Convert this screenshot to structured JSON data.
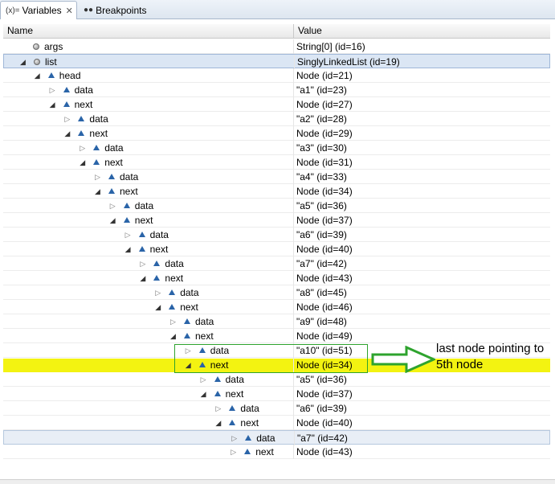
{
  "tabs": [
    {
      "label": "Variables",
      "icon": "variables-icon",
      "close": "✕"
    },
    {
      "label": "Breakpoints",
      "icon": "breakpoints-icon"
    }
  ],
  "columns": {
    "name": "Name",
    "value": "Value"
  },
  "rows": [
    {
      "name": "args",
      "value": "String[0]  (id=16)"
    },
    {
      "name": "list",
      "value": "SinglyLinkedList  (id=19)"
    },
    {
      "name": "head",
      "value": "Node  (id=21)"
    },
    {
      "name": "data",
      "value": "\"a1\" (id=23)"
    },
    {
      "name": "next",
      "value": "Node  (id=27)"
    },
    {
      "name": "data",
      "value": "\"a2\" (id=28)"
    },
    {
      "name": "next",
      "value": "Node  (id=29)"
    },
    {
      "name": "data",
      "value": "\"a3\" (id=30)"
    },
    {
      "name": "next",
      "value": "Node  (id=31)"
    },
    {
      "name": "data",
      "value": "\"a4\" (id=33)"
    },
    {
      "name": "next",
      "value": "Node  (id=34)"
    },
    {
      "name": "data",
      "value": "\"a5\" (id=36)"
    },
    {
      "name": "next",
      "value": "Node  (id=37)"
    },
    {
      "name": "data",
      "value": "\"a6\" (id=39)"
    },
    {
      "name": "next",
      "value": "Node  (id=40)"
    },
    {
      "name": "data",
      "value": "\"a7\" (id=42)"
    },
    {
      "name": "next",
      "value": "Node  (id=43)"
    },
    {
      "name": "data",
      "value": "\"a8\" (id=45)"
    },
    {
      "name": "next",
      "value": "Node  (id=46)"
    },
    {
      "name": "data",
      "value": "\"a9\" (id=48)"
    },
    {
      "name": "next",
      "value": "Node  (id=49)"
    },
    {
      "name": "data",
      "value": "\"a10\" (id=51)"
    },
    {
      "name": "next",
      "value": "Node  (id=34)"
    },
    {
      "name": "data",
      "value": "\"a5\" (id=36)"
    },
    {
      "name": "next",
      "value": "Node  (id=37)"
    },
    {
      "name": "data",
      "value": "\"a6\" (id=39)"
    },
    {
      "name": "next",
      "value": "Node  (id=40)"
    },
    {
      "name": "data",
      "value": "\"a7\" (id=42)"
    },
    {
      "name": "next",
      "value": "Node  (id=43)"
    }
  ],
  "annotation": {
    "text": "last node pointing to 5th node",
    "color": "#2ea32e"
  }
}
